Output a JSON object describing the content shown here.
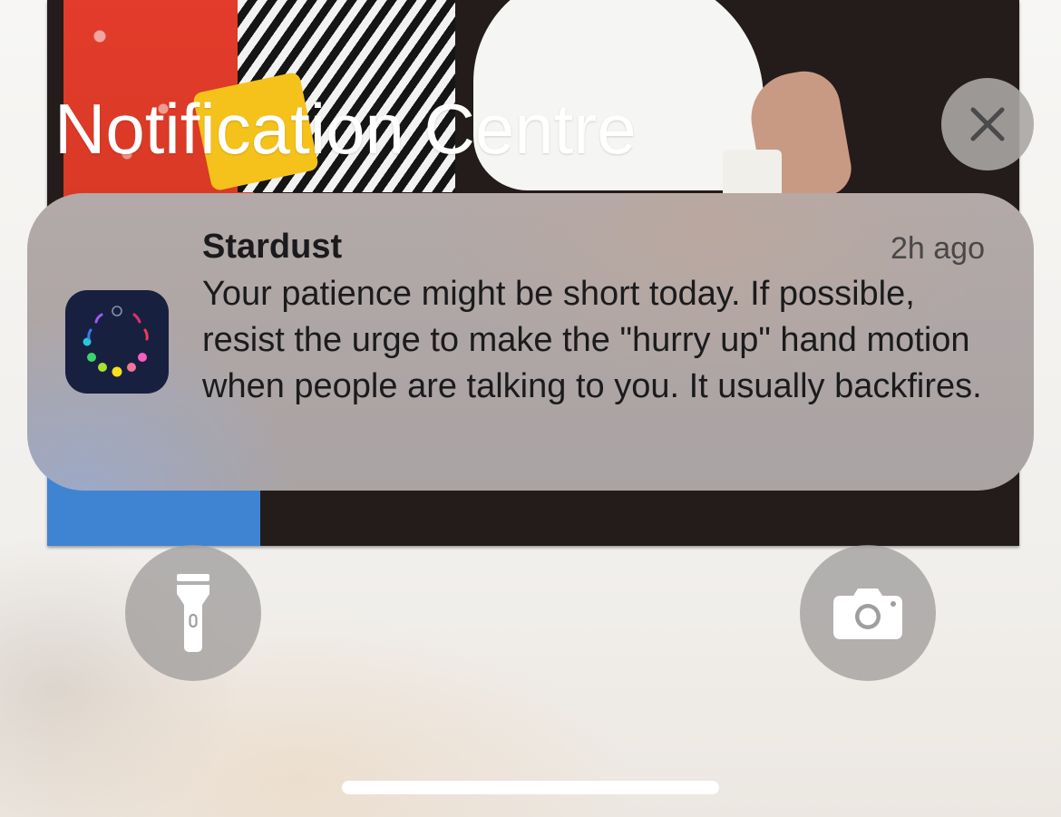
{
  "header": {
    "title": "Notification Centre",
    "close_icon": "close-icon"
  },
  "notification": {
    "app_name": "Stardust",
    "app_icon": "stardust-app-icon",
    "timestamp": "2h ago",
    "message": "Your patience might be short today. If possible, resist the urge to make the \"hurry up\" hand motion when people are talking to you. It usually backfires."
  },
  "quick_actions": {
    "flashlight_icon": "flashlight-icon",
    "camera_icon": "camera-icon"
  },
  "colors": {
    "app_icon_bg": "#17203f",
    "notification_bg": "#aaa3a3",
    "button_bg": "#a09e9c",
    "title_text": "#ffffff"
  }
}
